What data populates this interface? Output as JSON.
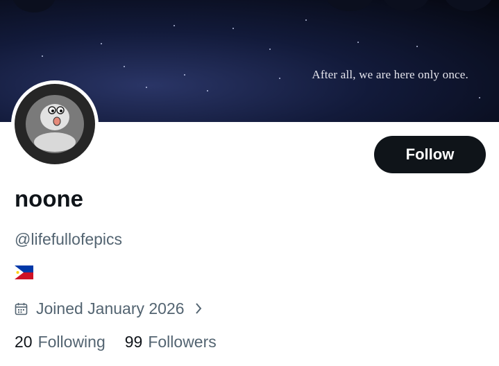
{
  "banner": {
    "caption": "After all, we are here only once."
  },
  "profile": {
    "display_name": "noone",
    "handle": "@lifefullofepics",
    "flag_icon": "philippines-flag",
    "joined": "Joined January 2026"
  },
  "actions": {
    "follow_label": "Follow"
  },
  "stats": {
    "following_count": "20",
    "following_label": "Following",
    "followers_count": "99",
    "followers_label": "Followers"
  },
  "colors": {
    "primary_text": "#0f1419",
    "secondary_text": "#536471",
    "button_bg": "#0f1419",
    "background": "#ffffff"
  }
}
